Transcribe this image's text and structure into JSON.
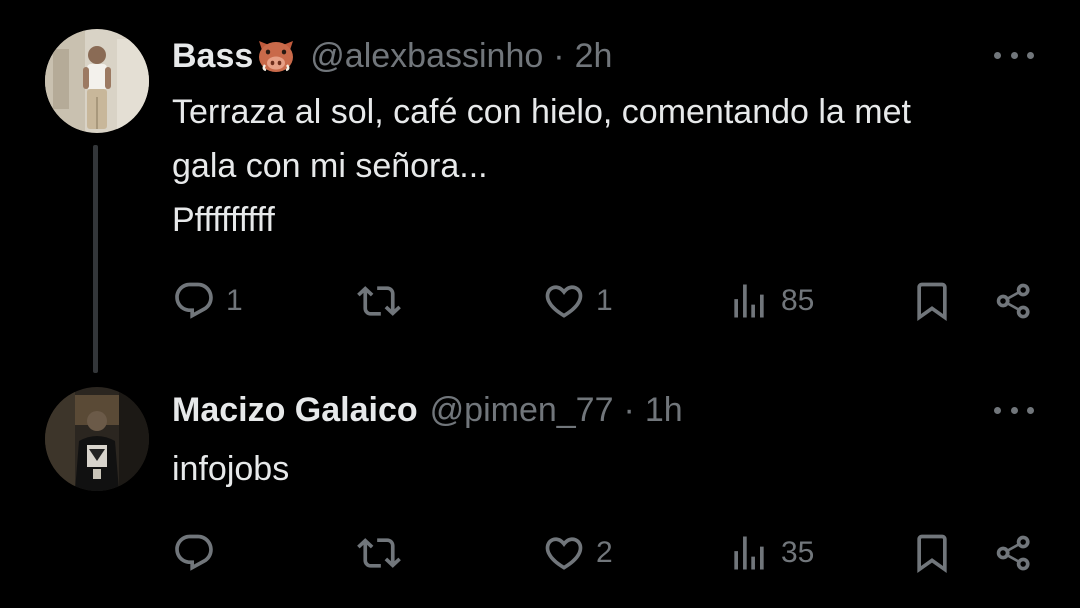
{
  "tweets": [
    {
      "author_name": "Bass",
      "author_emoji": "boar-face",
      "handle": "@alexbassinho",
      "separator": "·",
      "time": "2h",
      "text_lines": [
        "Terraza al sol, café con hielo, comentando la met",
        "gala con mi señora...",
        "Pfffffffff"
      ],
      "replies": "1",
      "retweets": "",
      "likes": "1",
      "views": "85"
    },
    {
      "author_name": "Macizo Galaico",
      "handle": "@pimen_77",
      "separator": "·",
      "time": "1h",
      "text_lines": [
        "infojobs"
      ],
      "replies": "",
      "retweets": "",
      "likes": "2",
      "views": "35"
    }
  ],
  "icons": {
    "reply": "reply-icon",
    "retweet": "retweet-icon",
    "like": "heart-icon",
    "views": "views-icon",
    "bookmark": "bookmark-icon",
    "share": "share-icon",
    "more": "more-options-icon"
  },
  "colors": {
    "background": "#000000",
    "primary_text": "#e7e9ea",
    "secondary_text": "#71767b",
    "thread_line": "#333639"
  }
}
